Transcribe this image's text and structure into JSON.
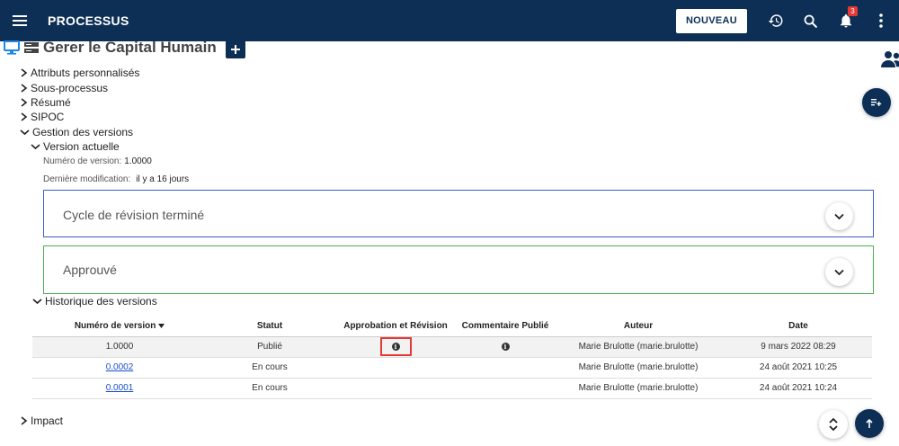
{
  "app": {
    "title": "PROCESSUS"
  },
  "toolbar": {
    "new_label": "NOUVEAU",
    "notification_count": "3"
  },
  "page": {
    "title": "Gerer le Capital Humain"
  },
  "tree": {
    "items": [
      "Attributs personnalisés",
      "Sous-processus",
      "Résumé",
      "SIPOC",
      "Gestion des versions"
    ],
    "current_version_label": "Version actuelle",
    "impact_label": "Impact"
  },
  "version": {
    "number_label": "Numéro de version:",
    "number_value": "1.0000",
    "modified_label": "Dernière modification:",
    "modified_value": "il y a 16 jours"
  },
  "panels": {
    "review_cycle": "Cycle de révision terminé",
    "approved": "Approuvé"
  },
  "history": {
    "label": "Historique des versions",
    "columns": [
      "Numéro de version",
      "Statut",
      "Approbation et Révision",
      "Commentaire Publié",
      "Auteur",
      "Date"
    ],
    "rows": [
      {
        "version": "1.0000",
        "status": "Publié",
        "author": "Marie Brulotte (marie.brulotte)",
        "date": "9 mars 2022 08:29"
      },
      {
        "version": "0.0002",
        "status": "En cours",
        "author": "Marie Brulotte (marie.brulotte)",
        "date": "24 août 2021 10:25"
      },
      {
        "version": "0.0001",
        "status": "En cours",
        "author": "Marie Brulotte (marie.brulotte)",
        "date": "24 août 2021 10:24"
      }
    ]
  },
  "colors": {
    "header": "#0d2f55",
    "review_border": "#3b5fc4",
    "approved_border": "#4caf50",
    "highlight": "#e53935"
  }
}
